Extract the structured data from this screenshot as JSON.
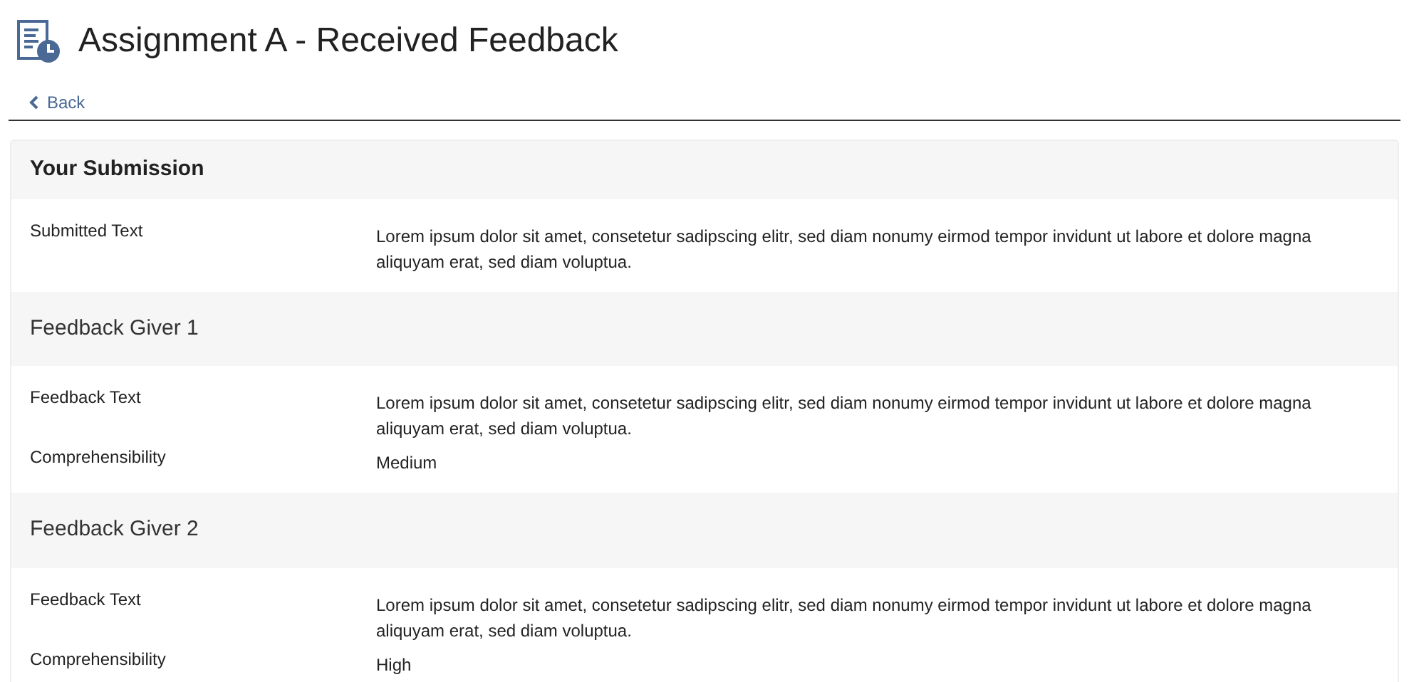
{
  "page": {
    "title": "Assignment A - Received Feedback",
    "back_link": "Back"
  },
  "submission": {
    "heading": "Your Submission",
    "fields": [
      {
        "label": "Submitted Text",
        "value": "Lorem ipsum dolor sit amet, consetetur sadipscing elitr, sed diam nonumy eirmod tempor invidunt ut labore et dolore magna aliquyam erat, sed diam voluptua."
      }
    ]
  },
  "feedback": [
    {
      "heading": "Feedback Giver 1",
      "fields": [
        {
          "label": "Feedback Text",
          "value": "Lorem ipsum dolor sit amet, consetetur sadipscing elitr, sed diam nonumy eirmod tempor invidunt ut labore et dolore magna aliquyam erat, sed diam voluptua."
        },
        {
          "label": "Comprehensibility",
          "value": "Medium"
        }
      ]
    },
    {
      "heading": "Feedback Giver 2",
      "fields": [
        {
          "label": "Feedback Text",
          "value": "Lorem ipsum dolor sit amet, consetetur sadipscing elitr, sed diam nonumy eirmod tempor invidunt ut labore et dolore magna aliquyam erat, sed diam voluptua."
        },
        {
          "label": "Comprehensibility",
          "value": "High"
        }
      ]
    }
  ]
}
